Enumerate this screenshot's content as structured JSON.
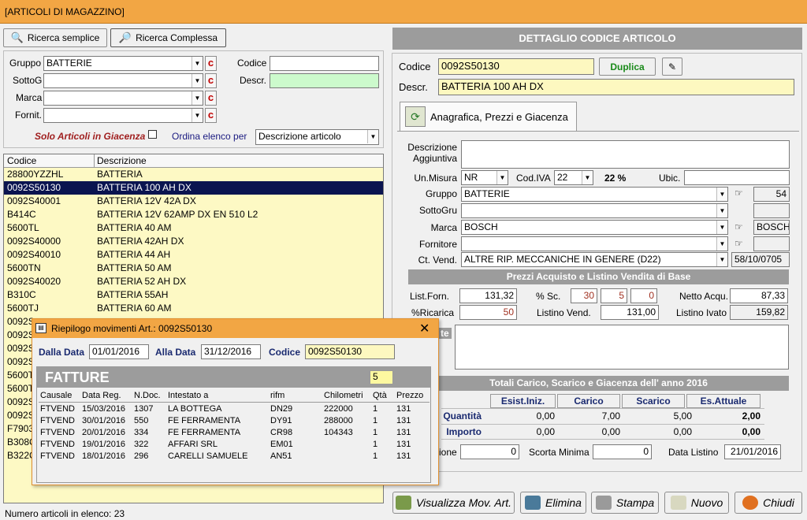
{
  "window": {
    "title": "[ARTICOLI DI MAGAZZINO]"
  },
  "search_tabs": {
    "simple": "Ricerca semplice",
    "complex": "Ricerca Complessa"
  },
  "filters": {
    "gruppo_label": "Gruppo",
    "gruppo_value": "BATTERIE",
    "sottog_label": "SottoG",
    "sottog_value": "",
    "marca_label": "Marca",
    "marca_value": "",
    "fornit_label": "Fornit.",
    "fornit_value": "",
    "clear_label": "c",
    "codice_label": "Codice",
    "codice_value": "",
    "descr_label": "Descr.",
    "descr_value": "",
    "solo_giacenza": "Solo Articoli in Giacenza",
    "ordina_label": "Ordina elenco per",
    "ordina_value": "Descrizione articolo"
  },
  "list": {
    "col_codice": "Codice",
    "col_descrizione": "Descrizione",
    "rows": [
      {
        "codice": "28800YZZHL",
        "descrizione": "BATTERIA"
      },
      {
        "codice": "0092S50130",
        "descrizione": "BATTERIA 100 AH DX"
      },
      {
        "codice": "0092S40001",
        "descrizione": "BATTERIA 12V 42A DX"
      },
      {
        "codice": "B414C",
        "descrizione": "BATTERIA 12V 62AMP DX EN 510 L2"
      },
      {
        "codice": "5600TL",
        "descrizione": "BATTERIA 40 AM"
      },
      {
        "codice": "0092S40000",
        "descrizione": "BATTERIA 42AH DX"
      },
      {
        "codice": "0092S40010",
        "descrizione": "BATTERIA 44 AH"
      },
      {
        "codice": "5600TN",
        "descrizione": "BATTERIA 50 AM"
      },
      {
        "codice": "0092S40020",
        "descrizione": "BATTERIA 52 AH DX"
      },
      {
        "codice": "B310C",
        "descrizione": "BATTERIA 55AH"
      },
      {
        "codice": "5600TJ",
        "descrizione": "BATTERIA 60 AM"
      },
      {
        "codice": "0092S",
        "descrizione": ""
      },
      {
        "codice": "0092S",
        "descrizione": ""
      },
      {
        "codice": "0092S",
        "descrizione": ""
      },
      {
        "codice": "0092S",
        "descrizione": ""
      },
      {
        "codice": "5600T",
        "descrizione": ""
      },
      {
        "codice": "5600T",
        "descrizione": ""
      },
      {
        "codice": "0092S",
        "descrizione": ""
      },
      {
        "codice": "0092S",
        "descrizione": ""
      },
      {
        "codice": "F7903",
        "descrizione": ""
      },
      {
        "codice": "B308C",
        "descrizione": ""
      },
      {
        "codice": "B322C",
        "descrizione": ""
      }
    ],
    "footer": "Numero articoli in elenco: 23"
  },
  "detail": {
    "header": "DETTAGLIO CODICE ARTICOLO",
    "codice_label": "Codice",
    "codice_value": "0092S50130",
    "duplica": "Duplica",
    "descr_label": "Descr.",
    "descr_value": "BATTERIA 100 AH DX",
    "tab": "Anagrafica, Prezzi e Giacenza",
    "desc_agg_label1": "Descrizione",
    "desc_agg_label2": "Aggiuntiva",
    "um_label": "Un.Misura",
    "um_value": "NR",
    "iva_label": "Cod.IVA",
    "iva_value": "22",
    "iva_pct": "22 %",
    "ubic_label": "Ubic.",
    "ubic_value": "",
    "gruppo_label": "Gruppo",
    "gruppo_value": "BATTERIE",
    "gruppo_code": "54",
    "sottogru_label": "SottoGru",
    "sottogru_value": "",
    "sottogru_code": "",
    "marca_label": "Marca",
    "marca_value": "BOSCH",
    "marca_code": "BOSCH",
    "fornitore_label": "Fornitore",
    "fornitore_value": "",
    "fornitore_code": "",
    "ctvend_label": "Ct. Vend.",
    "ctvend_value": "ALTRE RIP. MECCANICHE IN GENERE (D22)",
    "ctvend_code": "58/10/0705",
    "prezzi_header": "Prezzi Acquisto e Listino Vendita di Base",
    "listforn_label": "List.Forn.",
    "listforn_value": "131,32",
    "sc_label": "% Sc.",
    "sc1": "30",
    "sc2": "5",
    "sc3": "0",
    "netto_label": "Netto Acqu.",
    "netto_value": "87,33",
    "ricarica_label": "%Ricarica",
    "ricarica_value": "50",
    "listvend_label": "Listino Vend.",
    "listvend_value": "131,00",
    "listivato_label": "Listino Ivato",
    "listivato_value": "159,82",
    "note_label": "te",
    "totali_header": "Totali Carico, Scarico e Giacenza dell' anno 2016",
    "tot_cols": [
      "Esist.Iniz.",
      "Carico",
      "Scarico",
      "Es.Attuale"
    ],
    "quantita_label": "Quantità",
    "quantita": [
      "0,00",
      "7,00",
      "5,00",
      "2,00"
    ],
    "importo_label": "Importo",
    "importo": [
      "0,00",
      "0,00",
      "0,00",
      "0,00"
    ],
    "riordino_label": "ione",
    "riordino_value": "0",
    "scorta_label": "Scorta Minima",
    "scorta_value": "0",
    "datalist_label": "Data Listino",
    "datalist_value": "21/01/2016"
  },
  "actions": {
    "visualizza": "Visualizza Mov. Art.",
    "elimina": "Elimina",
    "stampa": "Stampa",
    "nuovo": "Nuovo",
    "chiudi": "Chiudi"
  },
  "dialog": {
    "title": "Riepilogo movimenti Art.: 0092S50130",
    "dalla_label": "Dalla Data",
    "dalla_value": "01/01/2016",
    "alla_label": "Alla Data",
    "alla_value": "31/12/2016",
    "codice_label": "Codice",
    "codice_value": "0092S50130",
    "fatture": "FATTURE",
    "count": "5",
    "cols": [
      "Causale",
      "Data Reg.",
      "N.Doc.",
      "Intestato a",
      "rifm",
      "Chilometri",
      "Qtà",
      "Prezzo"
    ],
    "rows": [
      [
        "FTVEND",
        "15/03/2016",
        "1307",
        "LA BOTTEGA",
        "DN29",
        "222000",
        "1",
        "131"
      ],
      [
        "FTVEND",
        "30/01/2016",
        "550",
        "FE FERRAMENTA",
        "DY91",
        "288000",
        "1",
        "131"
      ],
      [
        "FTVEND",
        "20/01/2016",
        "334",
        "FE FERRAMENTA",
        "CR98",
        "104343",
        "1",
        "131"
      ],
      [
        "FTVEND",
        "19/01/2016",
        "322",
        "AFFARI SRL",
        "EM01",
        "",
        "1",
        "131"
      ],
      [
        "FTVEND",
        "18/01/2016",
        "296",
        "CARELLI SAMUELE",
        "AN51",
        "",
        "1",
        "131"
      ]
    ]
  }
}
